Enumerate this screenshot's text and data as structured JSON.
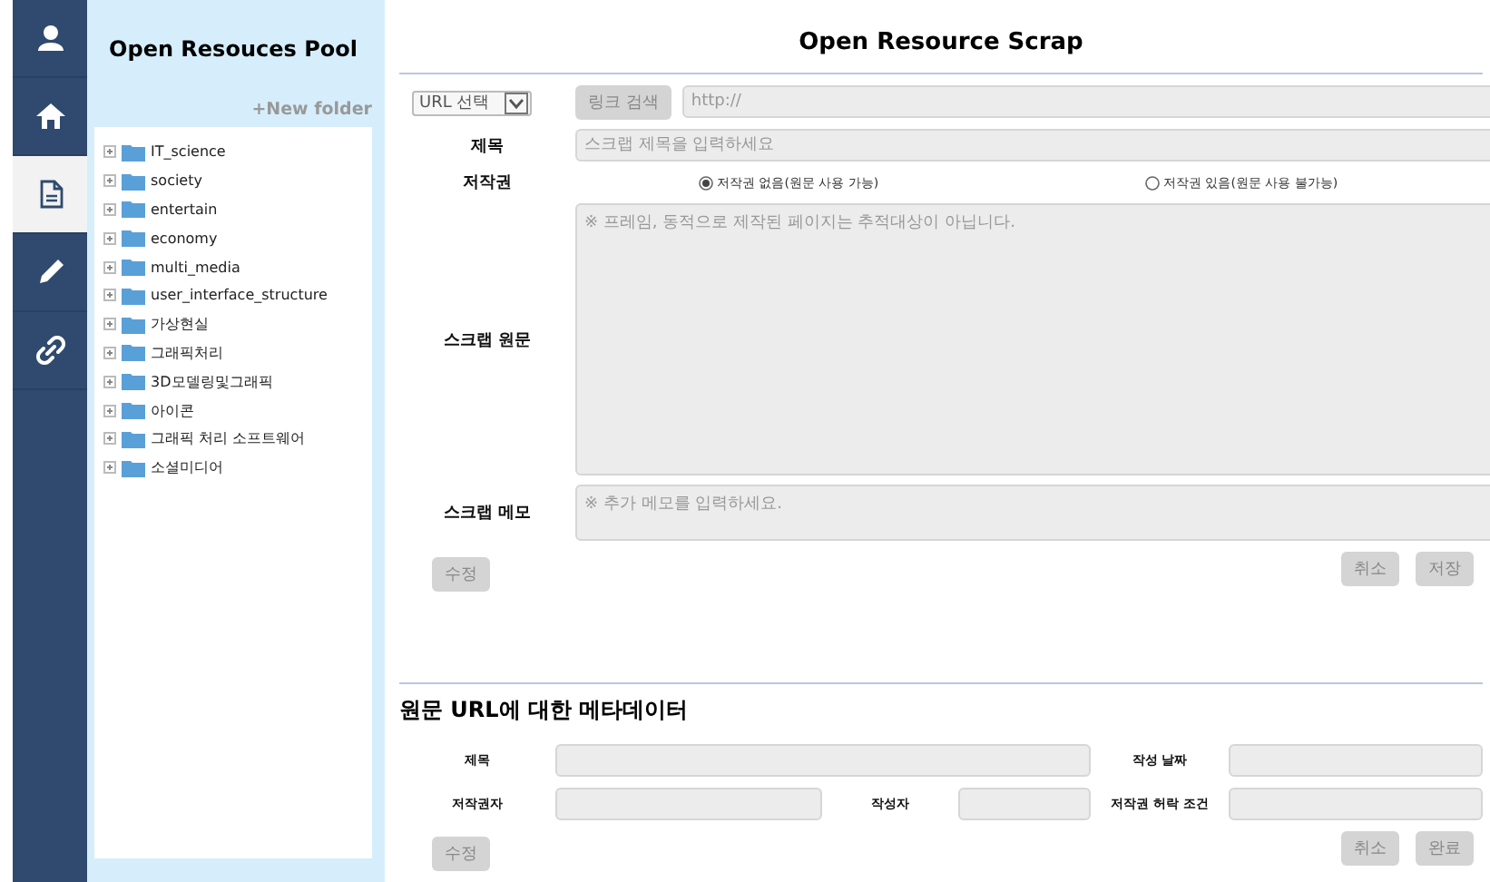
{
  "nav": [
    {
      "kind": "user",
      "selected": false
    },
    {
      "kind": "home",
      "selected": false
    },
    {
      "kind": "document",
      "selected": true
    },
    {
      "kind": "pencil",
      "selected": false
    },
    {
      "kind": "link",
      "selected": false
    }
  ],
  "sidebar": {
    "title": "Open Resouces Pool",
    "new_folder": "+New folder",
    "tree": [
      {
        "label": "IT_science",
        "expanded": false
      },
      {
        "label": "society",
        "expanded": false
      },
      {
        "label": "entertain",
        "expanded": false
      },
      {
        "label": "economy",
        "expanded": false
      },
      {
        "label": "multi_media",
        "expanded": false
      },
      {
        "label": "user_interface_structure",
        "expanded": false
      },
      {
        "label": "가상현실",
        "expanded": false
      },
      {
        "label": "그래픽처리",
        "expanded": false
      },
      {
        "label": "3D모델링및그래픽",
        "expanded": false
      },
      {
        "label": "아이콘",
        "expanded": false
      },
      {
        "label": "그래픽 처리 소프트웨어",
        "expanded": false
      },
      {
        "label": "소셜미디어",
        "expanded": false
      }
    ]
  },
  "scrap": {
    "title": "Open Resource Scrap",
    "url_select": {
      "value": "URL 선택"
    },
    "link_search_button": {
      "label": "링크 검색",
      "disabled": true
    },
    "url_field": {
      "placeholder": "http://"
    },
    "title_field": {
      "label": "제목",
      "placeholder": "스크랩 제목을 입력하세요"
    },
    "copyright": {
      "label": "저작권",
      "options": [
        {
          "label": "저작권 없음(원문 사용 가능)",
          "selected": true
        },
        {
          "label": "저작권 있음(원문 사용 불가능)",
          "selected": false
        }
      ]
    },
    "original": {
      "label": "스크랩 원문",
      "placeholder": "※ 프레임, 동적으로 제작된 페이지는 추적대상이 아닙니다."
    },
    "memo": {
      "label": "스크랩 메모",
      "placeholder": "※ 추가 메모를 입력하세요."
    },
    "left_buttons": [
      {
        "label": "수정",
        "disabled": true
      }
    ],
    "right_buttons": [
      {
        "label": "취소",
        "disabled": true
      },
      {
        "label": "저장",
        "disabled": true
      }
    ]
  },
  "metadata": {
    "heading": "원문 URL에 대한 메타데이터",
    "fields": [
      {
        "label": "제목",
        "kind": "wide"
      },
      {
        "label": "작성 날짜",
        "kind": "normal"
      },
      {
        "label": "저작권자",
        "kind": "normal"
      },
      {
        "label": "작성자",
        "kind": "normal"
      },
      {
        "label": "저작권 허락 조건",
        "kind": "normal"
      }
    ],
    "left_buttons": [
      {
        "label": "수정",
        "disabled": true
      }
    ],
    "right_buttons": [
      {
        "label": "취소",
        "disabled": true
      },
      {
        "label": "완료",
        "disabled": true
      }
    ]
  }
}
